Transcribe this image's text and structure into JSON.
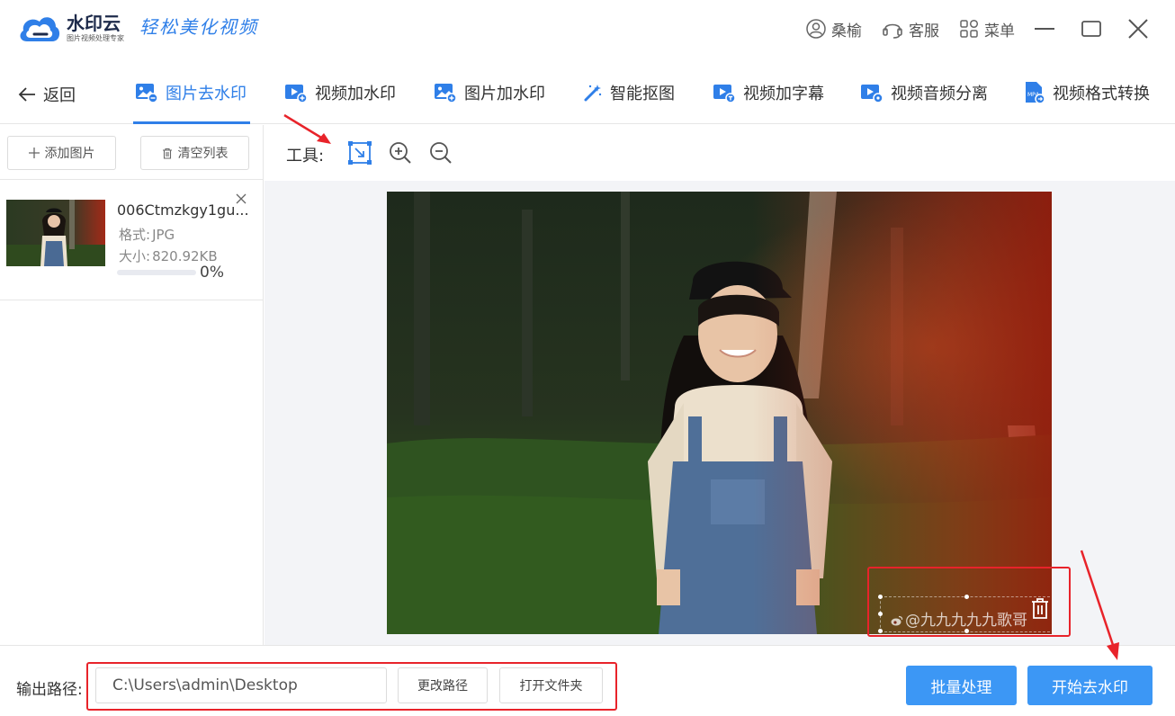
{
  "app": {
    "name": "水印云",
    "subtitle": "图片视频处理专家",
    "slogan": "轻松美化视频",
    "user": "桑榆",
    "support": "客服",
    "menu": "菜单"
  },
  "nav": {
    "back": "返回",
    "tabs": [
      {
        "label": "图片去水印",
        "active": true
      },
      {
        "label": "视频加水印",
        "active": false
      },
      {
        "label": "图片加水印",
        "active": false
      },
      {
        "label": "智能抠图",
        "active": false
      },
      {
        "label": "视频加字幕",
        "active": false
      },
      {
        "label": "视频音频分离",
        "active": false
      },
      {
        "label": "视频格式转换",
        "active": false
      }
    ]
  },
  "sidebar": {
    "add_label": "添加图片",
    "clear_label": "清空列表",
    "file": {
      "name": "006Ctmzkgy1gu...",
      "format_label": "格式:",
      "format": "JPG",
      "size_label": "大小:",
      "size": "820.92KB",
      "progress": 0,
      "progress_text": "0%"
    }
  },
  "toolbar": {
    "label": "工具:"
  },
  "canvas": {
    "watermark_text": "@九九九九九歌哥"
  },
  "bottom": {
    "output_label": "输出路径:",
    "output_path": "C:\\Users\\admin\\Desktop",
    "change_path": "更改路径",
    "open_folder": "打开文件夹",
    "batch": "批量处理",
    "start": "开始去水印"
  },
  "colors": {
    "accent": "#2f7fe8",
    "primary_button": "#3c97f5",
    "annotation": "#e8232a"
  }
}
